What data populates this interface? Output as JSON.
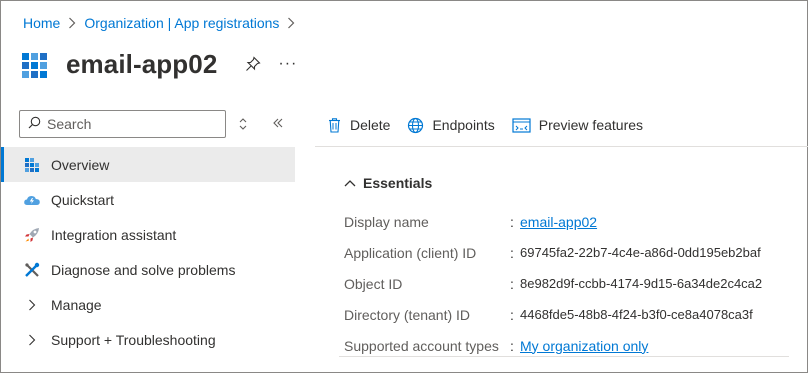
{
  "breadcrumb": {
    "items": [
      "Home",
      "Organization | App registrations"
    ]
  },
  "header": {
    "title": "email-app02",
    "more_label": "···"
  },
  "sidebar": {
    "search_placeholder": "Search",
    "items": [
      {
        "label": "Overview",
        "icon": "overview-grid-icon",
        "active": true
      },
      {
        "label": "Quickstart",
        "icon": "quickstart-cloud-icon"
      },
      {
        "label": "Integration assistant",
        "icon": "rocket-icon"
      },
      {
        "label": "Diagnose and solve problems",
        "icon": "wrench-icon"
      },
      {
        "label": "Manage",
        "icon": "chevron-right-icon"
      },
      {
        "label": "Support + Troubleshooting",
        "icon": "chevron-right-icon"
      }
    ]
  },
  "toolbar": {
    "delete_label": "Delete",
    "endpoints_label": "Endpoints",
    "preview_label": "Preview features"
  },
  "essentials": {
    "header": "Essentials",
    "rows": [
      {
        "label": "Display name",
        "value": "email-app02",
        "link": true
      },
      {
        "label": "Application (client) ID",
        "value": "69745fa2-22b7-4c4e-a86d-0dd195eb2baf"
      },
      {
        "label": "Object ID",
        "value": "8e982d9f-ccbb-4174-9d15-6a34de2c4ca2"
      },
      {
        "label": "Directory (tenant) ID",
        "value": "4468fde5-48b8-4f24-b3f0-ce8a4078ca3f"
      },
      {
        "label": "Supported account types",
        "value": "My organization only",
        "link": true
      }
    ]
  },
  "colors": {
    "accent": "#0078d4",
    "active_bg": "#ebebeb"
  }
}
